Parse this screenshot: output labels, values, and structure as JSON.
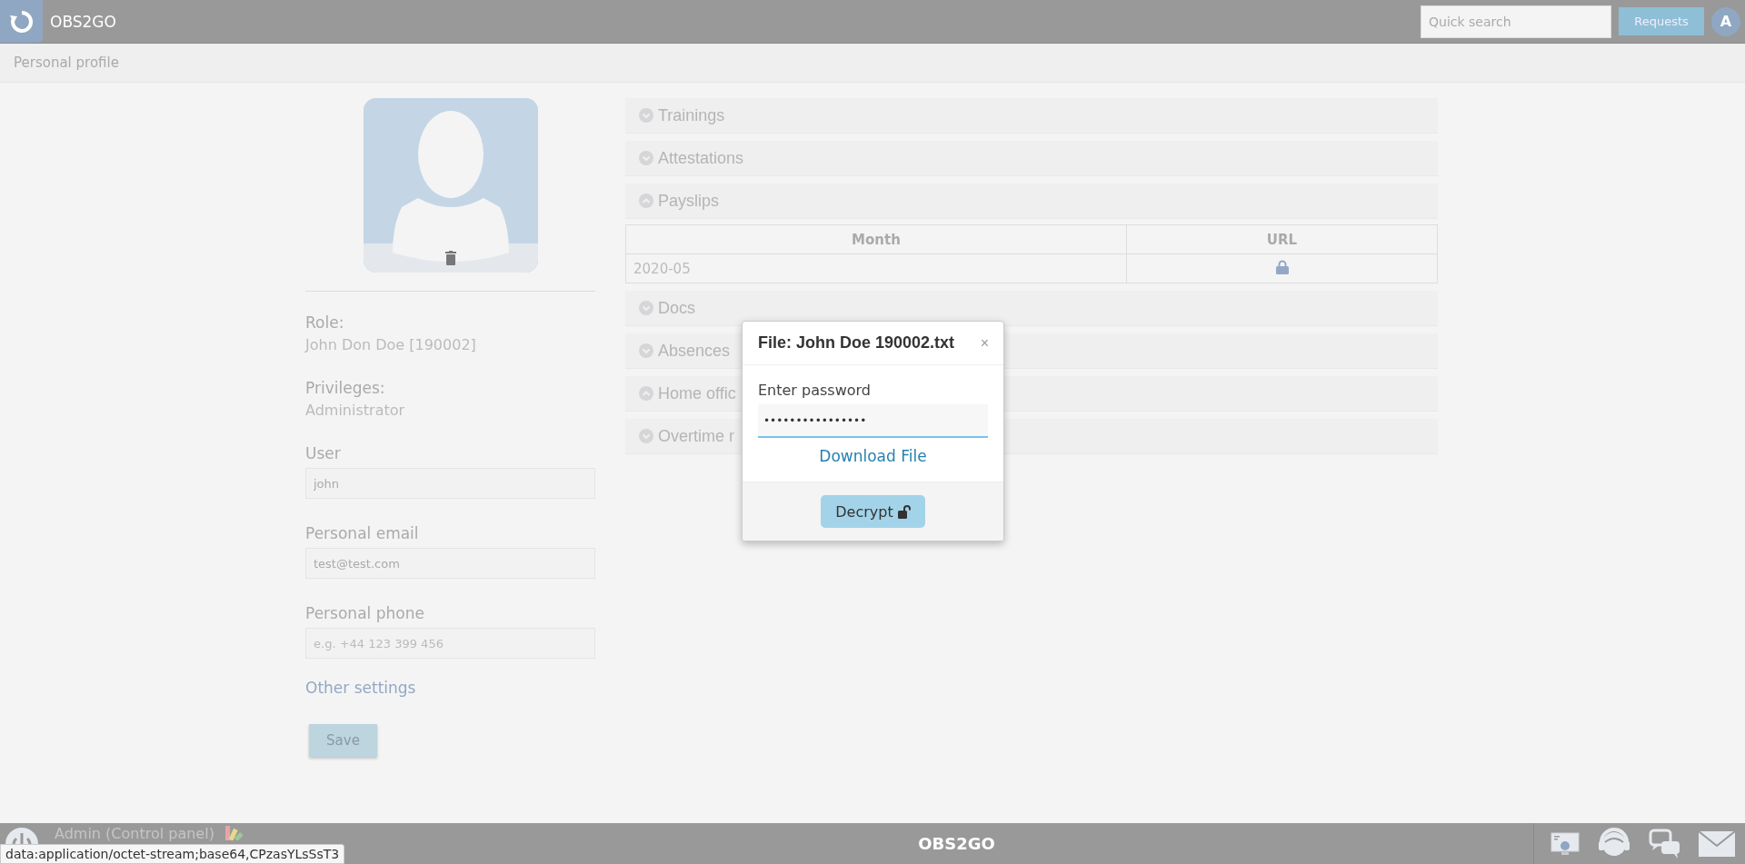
{
  "top_bar": {
    "app_name": "OBS2GO",
    "search": {
      "placeholder": "Quick search"
    },
    "requests_button": "Requests",
    "avatar_letter": "A"
  },
  "breadcrumb": "Personal profile",
  "profile": {
    "role_label": "Role:",
    "role_value": "John Don Doe [190002]",
    "privileges_label": "Privileges:",
    "privileges_value": "Administrator",
    "fields": [
      {
        "label": "User",
        "value": "john"
      },
      {
        "label": "Personal email",
        "value": "test@test.com"
      },
      {
        "label": "Personal phone",
        "placeholder": "e.g. +44 123 399 456"
      }
    ],
    "other_settings_link": "Other settings",
    "save_button": "Save"
  },
  "sections": [
    {
      "title": "Trainings",
      "expanded": false
    },
    {
      "title": "Attestations",
      "expanded": false
    },
    {
      "title": "Payslips",
      "expanded": true,
      "table": {
        "columns": [
          "Month",
          "URL"
        ],
        "rows": [
          {
            "month": "2020-05",
            "locked": true
          }
        ]
      }
    },
    {
      "title": "Docs",
      "expanded": false
    },
    {
      "title": "Absences",
      "expanded": false
    },
    {
      "title": "Home offic",
      "expanded": true
    },
    {
      "title": "Overtime r",
      "expanded": false
    }
  ],
  "dialog": {
    "title": "File: John Doe 190002.txt",
    "close": "×",
    "label": "Enter password",
    "password_value": "••••••••••••••••",
    "download_link": "Download File",
    "decrypt_button": "Decrypt"
  },
  "bottom_bar": {
    "admin_label": "Admin (Control panel)",
    "app_name": "OBS2GO"
  },
  "status_url": "data:application/octet-stream;base64,CPzasYLsSsT3"
}
